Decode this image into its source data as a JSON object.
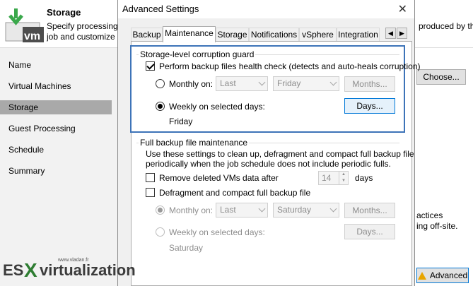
{
  "wizard": {
    "title": "Storage",
    "description_line1": "Specify processing pr",
    "description_line2": "job and customize ad",
    "description_right": "produced by this",
    "nav": [
      "Name",
      "Virtual Machines",
      "Storage",
      "Guest Processing",
      "Schedule",
      "Summary"
    ],
    "active_nav": "Storage",
    "choose_button": "Choose...",
    "right_text_1": "actices",
    "right_text_2": "ing off-site.",
    "advanced_button": "Advanced"
  },
  "dialog": {
    "title": "Advanced Settings",
    "tabs": [
      "Backup",
      "Maintenance",
      "Storage",
      "Notifications",
      "vSphere",
      "Integration"
    ],
    "active_tab": "Maintenance",
    "corruption_guard": {
      "group_label": "Storage-level corruption guard",
      "health_check_label": "Perform backup files health check (detects and auto-heals corruption)",
      "health_check_checked": true,
      "monthly_label": "Monthly on:",
      "monthly_week": "Last",
      "monthly_day": "Friday",
      "months_button": "Months...",
      "weekly_label": "Weekly on selected days:",
      "days_button": "Days...",
      "selected_days": "Friday"
    },
    "full_backup": {
      "group_label": "Full backup file maintenance",
      "description_line1": "Use these settings to clean up, defragment and compact full backup file",
      "description_line2": "periodically when the job schedule does not include periodic fulls.",
      "remove_deleted_label": "Remove deleted VMs data after",
      "remove_days_value": "14",
      "days_unit": "days",
      "defrag_label": "Defragment and compact full backup file",
      "monthly_label": "Monthly on:",
      "monthly_week": "Last",
      "monthly_day": "Saturday",
      "months_button": "Months...",
      "weekly_label": "Weekly on selected days:",
      "days_button": "Days...",
      "selected_days": "Saturday"
    }
  },
  "watermark": {
    "site": "www.vladan.fr",
    "es": "ES",
    "x": "X",
    "rest": "virtualization"
  },
  "colors": {
    "highlight_border": "#3d73b8",
    "active_nav": "#a9a9a9",
    "veeam_green": "#4caf50"
  }
}
